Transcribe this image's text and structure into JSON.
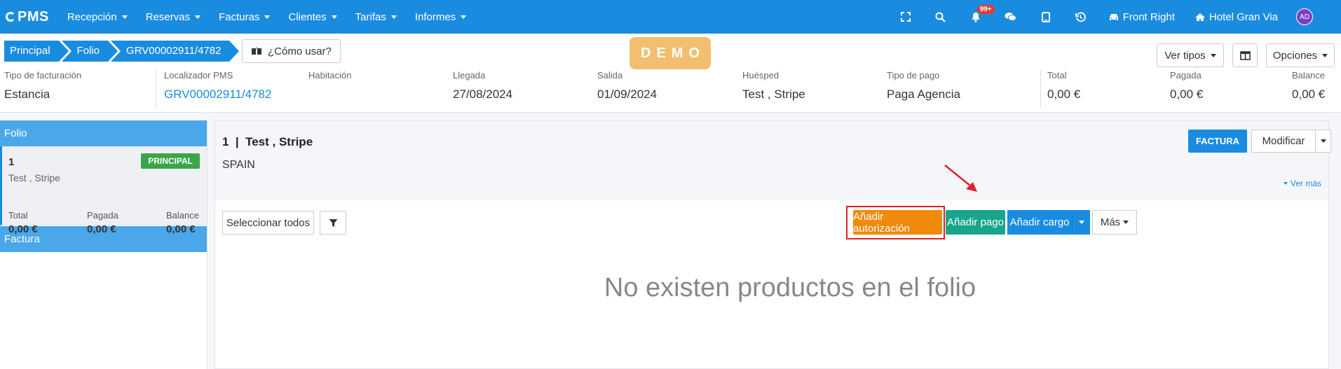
{
  "app": {
    "logo_text": "PMS",
    "brand_color": "#1a8ce0"
  },
  "nav": [
    {
      "label": "Recepción"
    },
    {
      "label": "Reservas"
    },
    {
      "label": "Facturas"
    },
    {
      "label": "Clientes"
    },
    {
      "label": "Tarifas"
    },
    {
      "label": "Informes"
    }
  ],
  "topright": {
    "icons": [
      "fullscreen-icon",
      "search-icon",
      "bell-icon",
      "chat-icon",
      "tablet-icon",
      "history-icon"
    ],
    "notif_count": "99+",
    "front_label": "Front Right",
    "hotel_label": "Hotel Gran Via",
    "avatar_initials": "AD"
  },
  "breadcrumb": [
    "Principal",
    "Folio",
    "GRV00002911/4782"
  ],
  "help_label": "¿Cómo usar?",
  "demo_label": "DEMO",
  "header_buttons": {
    "ver_tipos": "Ver tipos",
    "opciones": "Opciones"
  },
  "info": {
    "tipo_facturacion": {
      "label": "Tipo de facturación",
      "value": "Estancia"
    },
    "localizador": {
      "label": "Localizador PMS",
      "value": "GRV00002911/4782"
    },
    "habitacion": {
      "label": "Habitación",
      "value": ""
    },
    "llegada": {
      "label": "Llegada",
      "value": "27/08/2024"
    },
    "salida": {
      "label": "Salida",
      "value": "01/09/2024"
    },
    "huesped": {
      "label": "Huésped",
      "value": "Test , Stripe"
    },
    "tipo_pago": {
      "label": "Tipo de pago",
      "value": "Paga Agencia"
    },
    "total": {
      "label": "Total",
      "value": "0,00 €"
    },
    "pagada": {
      "label": "Pagada",
      "value": "0,00 €"
    },
    "balance": {
      "label": "Balance",
      "value": "0,00 €"
    }
  },
  "sidebar": {
    "folio_header": "Folio",
    "card": {
      "number": "1",
      "name": "Test , Stripe",
      "badge": "PRINCIPAL",
      "total_label": "Total",
      "total_value": "0,00 €",
      "pagada_label": "Pagada",
      "pagada_value": "0,00 €",
      "balance_label": "Balance",
      "balance_value": "0,00 €"
    },
    "factura_header": "Factura"
  },
  "main": {
    "folio_title": "1  |  Test , Stripe",
    "country": "SPAIN",
    "factura_button": "FACTURA",
    "modificar_button": "Modificar",
    "ver_mas": "Ver más",
    "select_all": "Seleccionar todos",
    "add_auth": "Añadir autorización",
    "add_payment": "Añadir pago",
    "add_charge": "Añadir cargo",
    "more": "Más",
    "empty_message": "No existen productos en el folio"
  }
}
